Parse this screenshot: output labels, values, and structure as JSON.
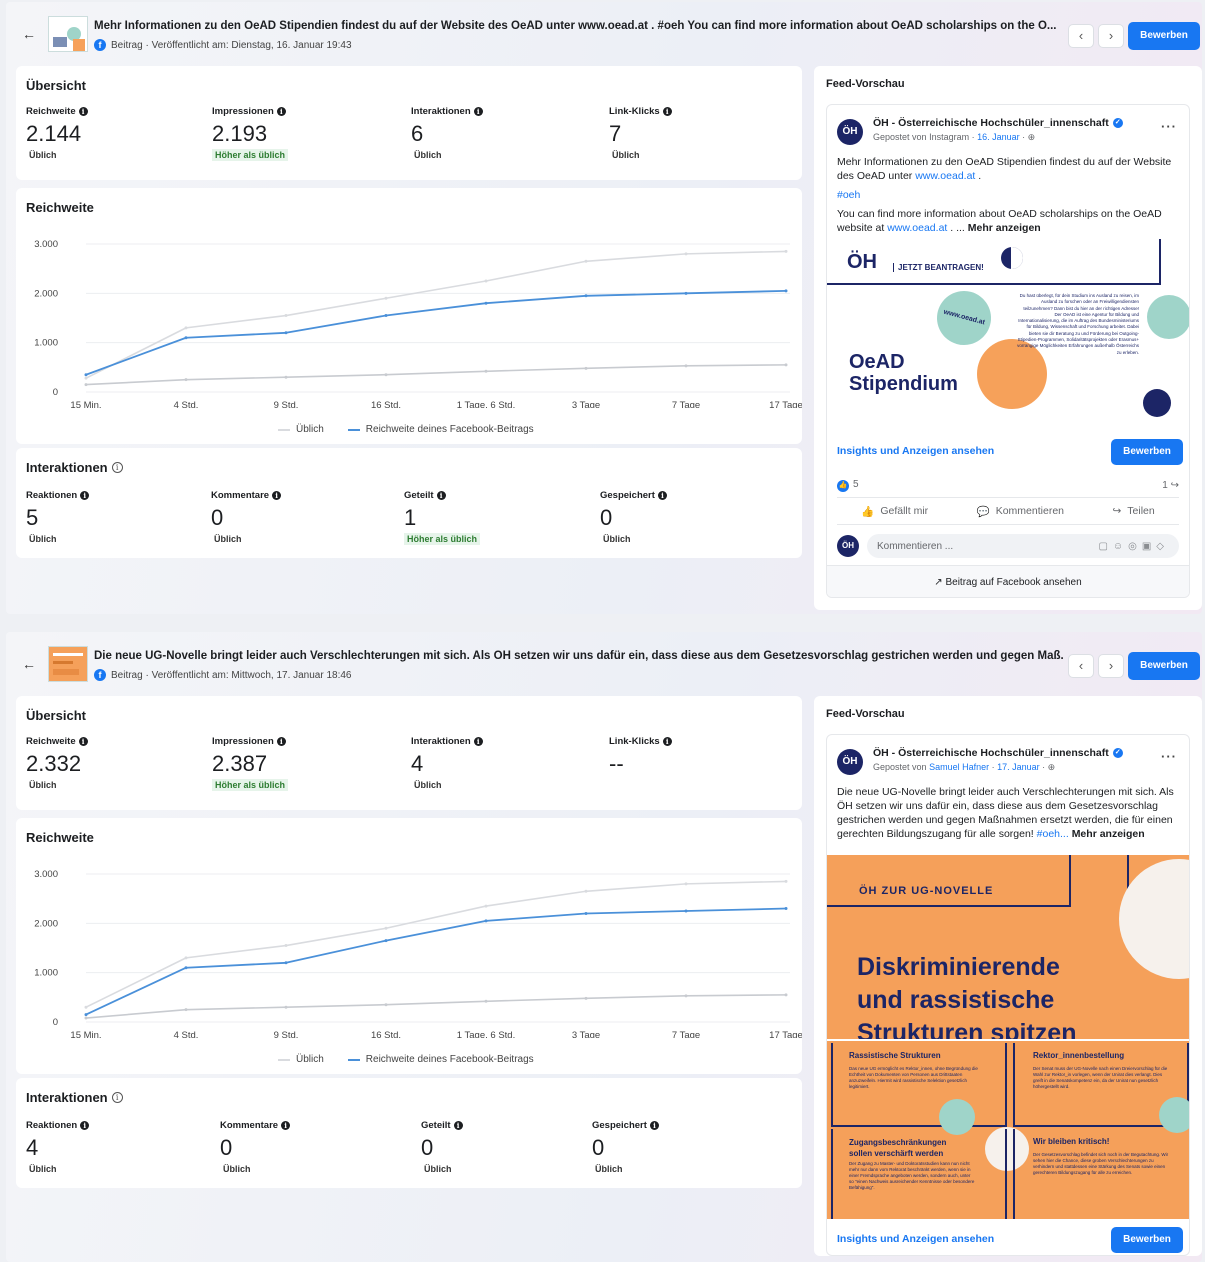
{
  "posts": [
    {
      "title": "Mehr Informationen zu den OeAD Stipendien findest du auf der Website des OeAD unter www.oead.at . #oeh You can find more information about OeAD scholarships on the O...",
      "meta": "Beitrag · Veröffentlicht am: Dienstag, 16. Januar 19:43",
      "apply_label": "Bewerben",
      "overview_title": "Übersicht",
      "metrics": [
        {
          "label": "Reichweite",
          "value": "2.144",
          "status": "Üblich"
        },
        {
          "label": "Impressionen",
          "value": "2.193",
          "status": "Höher als üblich"
        },
        {
          "label": "Interaktionen",
          "value": "6",
          "status": "Üblich"
        },
        {
          "label": "Link-Klicks",
          "value": "7",
          "status": "Üblich"
        }
      ],
      "reach_title": "Reichweite",
      "interactions_title": "Interaktionen",
      "interactions": [
        {
          "label": "Reaktionen",
          "value": "5",
          "status": "Üblich"
        },
        {
          "label": "Kommentare",
          "value": "0",
          "status": "Üblich"
        },
        {
          "label": "Geteilt",
          "value": "1",
          "status": "Höher als üblich"
        },
        {
          "label": "Gespeichert",
          "value": "0",
          "status": "Üblich"
        }
      ],
      "feed": {
        "title": "Feed-Vorschau",
        "page_name": "ÖH - Österreichische Hochschüler_innenschaft",
        "posted_prefix": "Gepostet von",
        "posted_by": "Instagram",
        "date": "16. Januar",
        "text1": "Mehr Informationen zu den OeAD Stipendien findest du auf der Website des OeAD unter",
        "link1": "www.oead.at",
        "text1_end": ".",
        "hashtag": "#oeh",
        "text2": "You can find more information about OeAD scholarships on the OeAD website at",
        "link2": "www.oead.at",
        "text2_mid": ". ...",
        "more": "Mehr anzeigen",
        "image": {
          "logo": "ÖH",
          "banner": "JETZT BEANTRAGEN!",
          "url_bubble": "www.oead.at",
          "heading_line1": "OeAD",
          "heading_line2": "Stipendium",
          "body": "Du hast überlegt, für dein Studium ins Ausland zu reisen, im Ausland zu forschen oder an Freiwilligendiensten teilzunehmen? Dann bist du hier an der richtigen Adresse! Der OeAD ist eine Agentur für Bildung und Internationalisierung, die im Auftrag des Bundesministeriums für Bildung, Wissenschaft und Forschung arbeitet. Dabei bieten sie dir Beratung zu und Förderung bei Outgoing- Stipedien-Programmen, Solidaritätsprojekten oder Erasmus+ vorrangige Möglichkeiten Erfahrungen außerhalb Österreichs zu erleben."
        },
        "insights_label": "Insights und Anzeigen ansehen",
        "apply_label": "Bewerben",
        "reactions_count": "5",
        "shares_count": "1",
        "like_label": "Gefällt mir",
        "comment_label": "Kommentieren",
        "share_label": "Teilen",
        "comment_placeholder": "Kommentieren ...",
        "view_on_fb": "Beitrag auf Facebook ansehen"
      }
    },
    {
      "title": "Die neue UG-Novelle bringt leider auch Verschlechterungen mit sich. Als ÖH setzen wir uns dafür ein, dass diese aus dem Gesetzesvorschlag gestrichen werden und gegen Maß...",
      "meta": "Beitrag · Veröffentlicht am: Mittwoch, 17. Januar 18:46",
      "apply_label": "Bewerben",
      "overview_title": "Übersicht",
      "metrics": [
        {
          "label": "Reichweite",
          "value": "2.332",
          "status": "Üblich"
        },
        {
          "label": "Impressionen",
          "value": "2.387",
          "status": "Höher als üblich"
        },
        {
          "label": "Interaktionen",
          "value": "4",
          "status": "Üblich"
        },
        {
          "label": "Link-Klicks",
          "value": "--",
          "status": ""
        }
      ],
      "reach_title": "Reichweite",
      "interactions_title": "Interaktionen",
      "interactions": [
        {
          "label": "Reaktionen",
          "value": "4",
          "status": "Üblich"
        },
        {
          "label": "Kommentare",
          "value": "0",
          "status": "Üblich"
        },
        {
          "label": "Geteilt",
          "value": "0",
          "status": "Üblich"
        },
        {
          "label": "Gespeichert",
          "value": "0",
          "status": "Üblich"
        }
      ],
      "feed": {
        "title": "Feed-Vorschau",
        "page_name": "ÖH - Österreichische Hochschüler_innenschaft",
        "posted_prefix": "Gepostet von",
        "posted_by": "Samuel Hafner",
        "date": "17. Januar",
        "text1": "Die neue UG-Novelle bringt leider auch Verschlechterungen mit sich. Als ÖH setzen wir uns dafür ein, dass diese aus dem Gesetzesvorschlag gestrichen werden und gegen Maßnahmen ersetzt werden, die für einen gerechten Bildungszugang für alle sorgen!",
        "hashtag": "#oeh...",
        "more": "Mehr anzeigen",
        "image": {
          "banner": "ÖH ZUR UG-NOVELLE",
          "heading_line1": "Diskriminierende",
          "heading_line2": "und rassistische",
          "heading_line3": "Strukturen spitzen",
          "box1_title": "Rassistische Strukturen",
          "box1_text": "Das neue UG ermöglicht es Rektor_innen, ohne Begründung die Echtheit von Dokumenten von Personen aus Drittstaaten anzuzweifeln. Hiermit wird rassistische Selektion gesetzlich legitimiert.",
          "box2_title": "Rektor_innenbestellung",
          "box2_text": "Der Senat muss der UG-Novelle nach einen Dreiervorschlag für die Wahl zur Rektor_in vorlegen, wenn der Unirat dies verlangt. Dies greift in die Senatskompetenz ein, da der Unirat nun gesetzlich höhergestellt wird.",
          "box3_title_line1": "Zugangsbeschränkungen",
          "box3_title_line2": "sollen verschärft werden",
          "box3_text": "Der Zugang zu Master- und Doktoratsstudien kann nun nicht mehr nur dann vom Rektorat beschränkt werden, wenn sie in einer Fremdsprache angeboten werden, sondern auch, unter so \"einen Nachweis ausreichender Kenntnisse oder besondere Befähigung\".",
          "box4_title": "Wir bleiben kritisch!",
          "box4_text": "Der Gesetzesvorschlag befindet sich noch in der Begutachtung. Wir sehen hier die Chance, diese groben Verschlechterungen zu verhindern und stattdessen eine Stärkung des Senats sowie einen gerechteren Bildungszugang für alle zu erreichen."
        },
        "insights_label": "Insights und Anzeigen ansehen",
        "apply_label": "Bewerben"
      }
    }
  ],
  "icons": {
    "back": "←",
    "prev": "‹",
    "next": "›",
    "info": "i",
    "more": "···",
    "like": "👍",
    "comment": "💬",
    "share": "↪",
    "external": "↗"
  },
  "colors": {
    "typical_line": "#d9dbdf",
    "reach_line": "#4a90d9",
    "lower_line": "#c8cbd0",
    "accent": "#1877f2",
    "higher_badge_bg": "#e6f4ea",
    "higher_badge_text": "#2e7d32",
    "oead_orange": "#f6a15a",
    "oead_teal": "#9fd4c9",
    "oead_navy": "#1c2566",
    "ug_orange": "#f5a05a"
  },
  "chart_data": [
    {
      "type": "line",
      "title": "Reichweite",
      "x": [
        "15 Min.",
        "4 Std.",
        "9 Std.",
        "16 Std.",
        "1 Tage, 6 Std.",
        "3 Tage",
        "7 Tage",
        "17 Tage"
      ],
      "yticks": [
        "0",
        "1.000",
        "2.000",
        "3.000"
      ],
      "ylim": [
        0,
        3000
      ],
      "legend_position": "bottom",
      "series": [
        {
          "name": "Üblich",
          "values": [
            280,
            1300,
            1550,
            1900,
            2250,
            2650,
            2800,
            2850
          ]
        },
        {
          "name": "Reichweite deines Facebook-Beitrags",
          "values": [
            350,
            1100,
            1200,
            1550,
            1800,
            1950,
            2000,
            2050
          ]
        },
        {
          "name": "",
          "values": [
            150,
            250,
            300,
            350,
            420,
            480,
            530,
            550
          ]
        }
      ]
    },
    {
      "type": "line",
      "title": "Reichweite",
      "x": [
        "15 Min.",
        "4 Std.",
        "9 Std.",
        "16 Std.",
        "1 Tage, 6 Std.",
        "3 Tage",
        "7 Tage",
        "17 Tage"
      ],
      "yticks": [
        "0",
        "1.000",
        "2.000",
        "3.000"
      ],
      "ylim": [
        0,
        3000
      ],
      "legend_position": "bottom",
      "series": [
        {
          "name": "Üblich",
          "values": [
            300,
            1300,
            1550,
            1900,
            2350,
            2650,
            2800,
            2850
          ]
        },
        {
          "name": "Reichweite deines Facebook-Beitrags",
          "values": [
            150,
            1100,
            1200,
            1650,
            2050,
            2200,
            2250,
            2300
          ]
        },
        {
          "name": "",
          "values": [
            80,
            250,
            300,
            350,
            420,
            480,
            530,
            550
          ]
        }
      ]
    }
  ]
}
